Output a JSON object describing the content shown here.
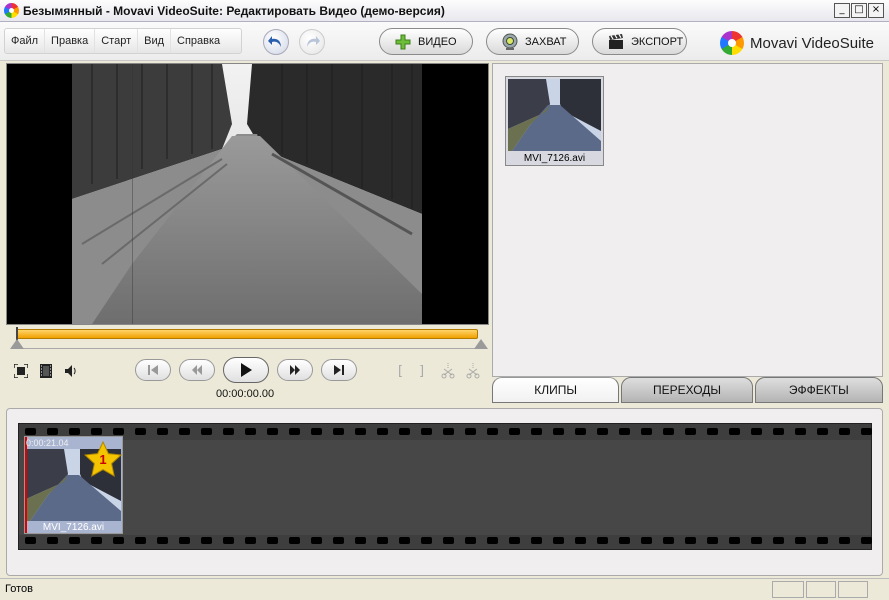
{
  "window": {
    "title": "Безымянный - Movavi VideoSuite: Редактировать Видео (демо-версия)"
  },
  "menu": [
    {
      "label": "Файл"
    },
    {
      "label": "Правка"
    },
    {
      "label": "Старт"
    },
    {
      "label": "Вид"
    },
    {
      "label": "Справка"
    }
  ],
  "toolbar": {
    "video_label": "ВИДЕО",
    "capture_label": "ЗАХВАТ",
    "export_label": "ЭКСПОРТ"
  },
  "brand": {
    "name": "Movavi VideoSuite"
  },
  "player": {
    "timecode": "00:00:00.00"
  },
  "clips_panel": {
    "clip_name": "MVI_7126.avi"
  },
  "tabs": [
    {
      "label": "КЛИПЫ",
      "active": true
    },
    {
      "label": "ПЕРЕХОДЫ"
    },
    {
      "label": "ЭФФЕКТЫ"
    }
  ],
  "storyboard": {
    "clip_duration": "0:00:21.04",
    "clip_name": "MVI_7126.avi",
    "clip_number": "1"
  },
  "status": {
    "text": "Готов"
  },
  "colors": {
    "timeline_orange": "#f0a000",
    "film_dark": "#3e3e3e",
    "star": "#f5c400"
  }
}
